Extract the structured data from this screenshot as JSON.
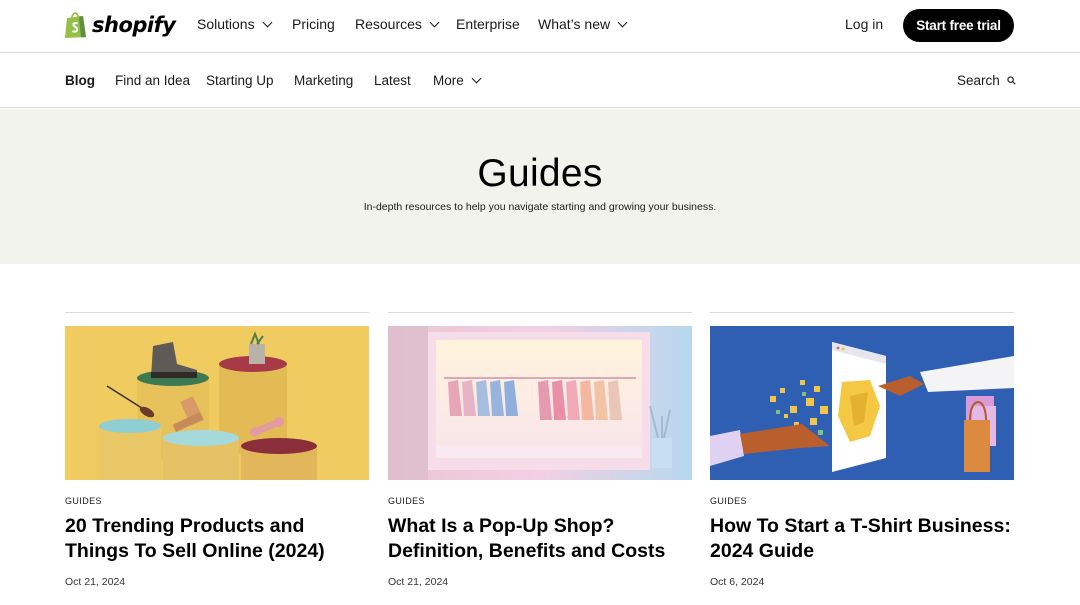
{
  "brand": {
    "name": "shopify"
  },
  "topnav": {
    "items": [
      {
        "label": "Solutions",
        "dropdown": true
      },
      {
        "label": "Pricing",
        "dropdown": false
      },
      {
        "label": "Resources",
        "dropdown": true
      },
      {
        "label": "Enterprise",
        "dropdown": false
      },
      {
        "label": "What’s new",
        "dropdown": true
      }
    ],
    "login_label": "Log in",
    "cta_label": "Start free trial"
  },
  "blognav": {
    "items": [
      {
        "label": "Blog",
        "active": true
      },
      {
        "label": "Find an Idea"
      },
      {
        "label": "Starting Up"
      },
      {
        "label": "Marketing"
      },
      {
        "label": "Latest"
      },
      {
        "label": "More",
        "dropdown": true
      }
    ],
    "search_label": "Search"
  },
  "hero": {
    "title": "Guides",
    "subtitle": "In-depth resources to help you navigate starting and growing your business."
  },
  "articles": [
    {
      "category": "GUIDES",
      "title": "20 Trending Products and Things To Sell Online (2024)",
      "date": "Oct 21, 2024"
    },
    {
      "category": "GUIDES",
      "title": "What Is a Pop-Up Shop? Definition, Benefits and Costs",
      "date": "Oct 21, 2024"
    },
    {
      "category": "GUIDES",
      "title": "How To Start a T-Shirt Business: 2024 Guide",
      "date": "Oct 6, 2024"
    }
  ],
  "colors": {
    "brand_green": "#95bf47",
    "hero_bg": "#f3f3ee",
    "cta_bg": "#000000"
  }
}
